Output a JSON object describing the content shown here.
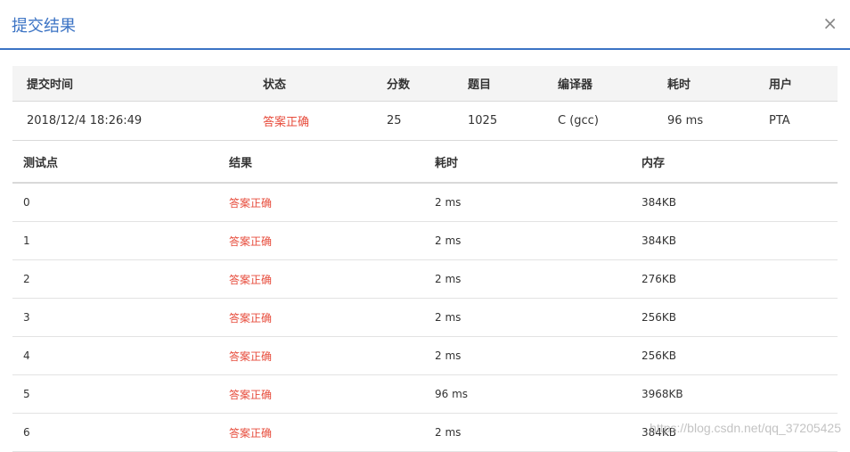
{
  "dialog": {
    "title": "提交结果",
    "close_label": "×"
  },
  "summary": {
    "headers": [
      "提交时间",
      "状态",
      "分数",
      "题目",
      "编译器",
      "耗时",
      "用户"
    ],
    "row": [
      "2018/12/4 18:26:49",
      "答案正确",
      "25",
      "1025",
      "C (gcc)",
      "96 ms",
      "PTA"
    ]
  },
  "tests": {
    "headers": [
      "测试点",
      "结果",
      "耗时",
      "内存"
    ],
    "rows": [
      [
        "0",
        "答案正确",
        "2 ms",
        "384KB"
      ],
      [
        "1",
        "答案正确",
        "2 ms",
        "384KB"
      ],
      [
        "2",
        "答案正确",
        "2 ms",
        "276KB"
      ],
      [
        "3",
        "答案正确",
        "2 ms",
        "256KB"
      ],
      [
        "4",
        "答案正确",
        "2 ms",
        "256KB"
      ],
      [
        "5",
        "答案正确",
        "96 ms",
        "3968KB"
      ],
      [
        "6",
        "答案正确",
        "2 ms",
        "384KB"
      ]
    ]
  },
  "watermark": "https://blog.csdn.net/qq_37205425",
  "colors": {
    "accent": "#3b73c4",
    "status_ok": "#e74c3c"
  }
}
